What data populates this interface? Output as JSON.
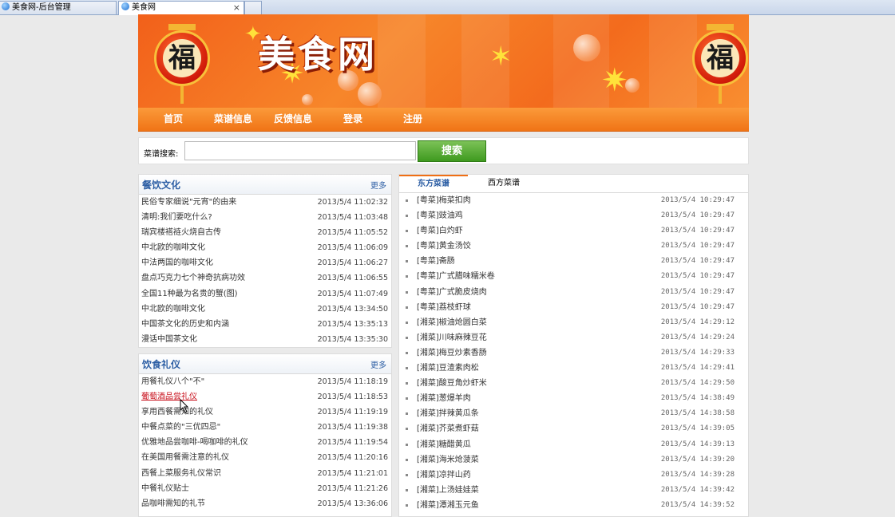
{
  "browser": {
    "tabs": [
      {
        "label": "美食网-后台管理"
      },
      {
        "label": "美食网",
        "close": "×"
      }
    ]
  },
  "banner": {
    "logo": "美食网",
    "lantern_char": "福"
  },
  "nav": {
    "items": [
      "首页",
      "菜谱信息",
      "反馈信息",
      "登录",
      "注册"
    ]
  },
  "search": {
    "label": "菜谱搜索:",
    "value": "",
    "button": "搜索"
  },
  "culture": {
    "title": "餐饮文化",
    "more": "更多",
    "items": [
      {
        "title": "民俗专家细说\"元宵\"的由来",
        "date": "2013/5/4 11:02:32"
      },
      {
        "title": "清明:我们要吃什么?",
        "date": "2013/5/4 11:03:48"
      },
      {
        "title": "瑞宾楼褡裢火烧自古传",
        "date": "2013/5/4 11:05:52"
      },
      {
        "title": "中北欧的咖啡文化",
        "date": "2013/5/4 11:06:09"
      },
      {
        "title": "中法两国的咖啡文化",
        "date": "2013/5/4 11:06:27"
      },
      {
        "title": "盘点巧克力七个神奇抗病功效",
        "date": "2013/5/4 11:06:55"
      },
      {
        "title": "全国11种最为名贵的蟹(图)",
        "date": "2013/5/4 11:07:49"
      },
      {
        "title": "中北欧的咖啡文化",
        "date": "2013/5/4 13:34:50"
      },
      {
        "title": "中国茶文化的历史和内涵",
        "date": "2013/5/4 13:35:13"
      },
      {
        "title": "漫话中国茶文化",
        "date": "2013/5/4 13:35:30"
      }
    ]
  },
  "etiquette": {
    "title": "饮食礼仪",
    "more": "更多",
    "items": [
      {
        "title": "用餐礼仪八个\"不\"",
        "date": "2013/5/4 11:18:19"
      },
      {
        "title": "葡萄酒品尝礼仪",
        "date": "2013/5/4 11:18:53"
      },
      {
        "title": "享用西餐需知的礼仪",
        "date": "2013/5/4 11:19:19"
      },
      {
        "title": "中餐点菜的\"三优四忌\"",
        "date": "2013/5/4 11:19:38"
      },
      {
        "title": "优雅地品尝咖啡-喝咖啡的礼仪",
        "date": "2013/5/4 11:19:54"
      },
      {
        "title": "在美国用餐需注意的礼仪",
        "date": "2013/5/4 11:20:16"
      },
      {
        "title": "西餐上菜服务礼仪常识",
        "date": "2013/5/4 11:21:01"
      },
      {
        "title": "中餐礼仪贴士",
        "date": "2013/5/4 11:21:26"
      },
      {
        "title": "品咖啡需知的礼节",
        "date": "2013/5/4 13:36:06"
      }
    ]
  },
  "recipes": {
    "tabs": [
      "东方菜谱",
      "西方菜谱"
    ],
    "items": [
      {
        "title": "[粤菜]梅菜扣肉",
        "date": "2013/5/4 10:29:47"
      },
      {
        "title": "[粤菜]豉油鸡",
        "date": "2013/5/4 10:29:47"
      },
      {
        "title": "[粤菜]白灼虾",
        "date": "2013/5/4 10:29:47"
      },
      {
        "title": "[粤菜]黄金汤饺",
        "date": "2013/5/4 10:29:47"
      },
      {
        "title": "[粤菜]斋肠",
        "date": "2013/5/4 10:29:47"
      },
      {
        "title": "[粤菜]广式腊味糯米卷",
        "date": "2013/5/4 10:29:47"
      },
      {
        "title": "[粤菜]广式脆皮烧肉",
        "date": "2013/5/4 10:29:47"
      },
      {
        "title": "[粤菜]荔枝虾球",
        "date": "2013/5/4 10:29:47"
      },
      {
        "title": "[湘菜]椒油炝圆白菜",
        "date": "2013/5/4 14:29:12"
      },
      {
        "title": "[湘菜]川味麻辣豆花",
        "date": "2013/5/4 14:29:24"
      },
      {
        "title": "[湘菜]梅豆炒素香肠",
        "date": "2013/5/4 14:29:33"
      },
      {
        "title": "[湘菜]豆渣素肉松",
        "date": "2013/5/4 14:29:41"
      },
      {
        "title": "[湘菜]酸豆角炒虾米",
        "date": "2013/5/4 14:29:50"
      },
      {
        "title": "[湘菜]葱爆羊肉",
        "date": "2013/5/4 14:38:49"
      },
      {
        "title": "[湘菜]拌辣黄瓜条",
        "date": "2013/5/4 14:38:58"
      },
      {
        "title": "[湘菜]芥菜煮虾菇",
        "date": "2013/5/4 14:39:05"
      },
      {
        "title": "[湘菜]糖醋黄瓜",
        "date": "2013/5/4 14:39:13"
      },
      {
        "title": "[湘菜]海米炝菠菜",
        "date": "2013/5/4 14:39:20"
      },
      {
        "title": "[湘菜]凉拌山药",
        "date": "2013/5/4 14:39:28"
      },
      {
        "title": "[湘菜]上汤娃娃菜",
        "date": "2013/5/4 14:39:42"
      },
      {
        "title": "[湘菜]潭湘玉元鱼",
        "date": "2013/5/4 14:39:52"
      }
    ]
  }
}
